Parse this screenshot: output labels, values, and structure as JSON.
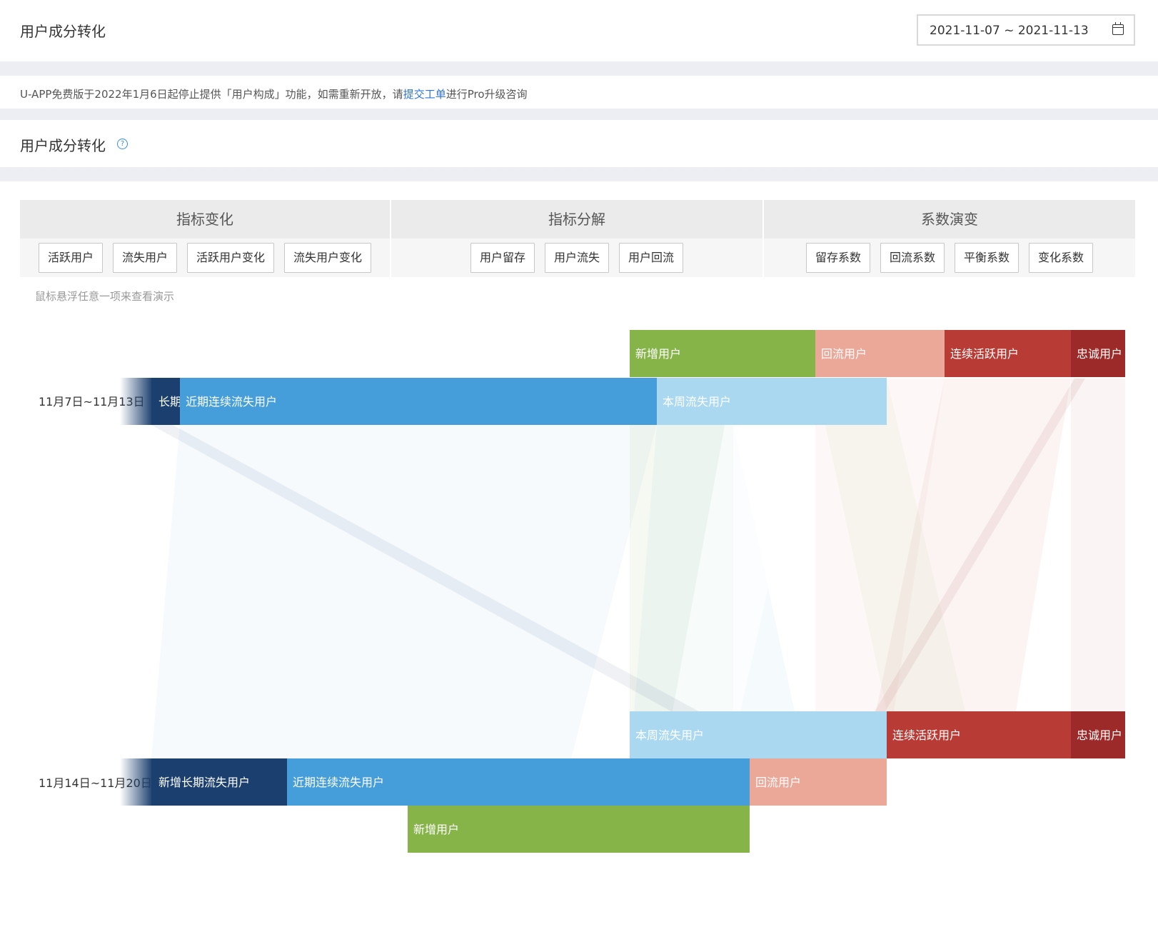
{
  "header": {
    "title": "用户成分转化",
    "date_range": "2021-11-07 ~ 2021-11-13",
    "calendar_icon": "calendar-icon"
  },
  "notice": {
    "text_before": "U-APP免费版于2022年1月6日起停止提供「用户构成」功能，如需重新开放，请",
    "link_text": "提交工单",
    "text_after": "进行Pro升级咨询"
  },
  "section": {
    "title": "用户成分转化",
    "help_icon": "question-circle-icon"
  },
  "tabs": [
    {
      "title": "指标变化",
      "buttons": [
        "活跃用户",
        "流失用户",
        "活跃用户变化",
        "流失用户变化"
      ]
    },
    {
      "title": "指标分解",
      "buttons": [
        "用户留存",
        "用户流失",
        "用户回流"
      ]
    },
    {
      "title": "系数演变",
      "buttons": [
        "留存系数",
        "回流系数",
        "平衡系数",
        "变化系数"
      ]
    }
  ],
  "hint": "鼠标悬浮任意一项来查看演示",
  "chart": {
    "colors": {
      "new": "#87b449",
      "return": "#eba797",
      "active": "#b83c35",
      "loyal": "#9c2a28",
      "long_lost": "#1b3f6e",
      "recent_lost": "#459ed9",
      "week_lost": "#aad8f0"
    },
    "week1": {
      "label": "11月7日~11月13日",
      "top_bars": [
        {
          "label": "新增用户",
          "color": "new"
        },
        {
          "label": "回流用户",
          "color": "return"
        },
        {
          "label": "连续活跃用户",
          "color": "active"
        },
        {
          "label": "忠诚用户",
          "color": "loyal"
        }
      ],
      "bars": [
        {
          "label": "长期",
          "color": "long_lost"
        },
        {
          "label": "近期连续流失用户",
          "color": "recent_lost"
        },
        {
          "label": "本周流失用户",
          "color": "week_lost"
        }
      ]
    },
    "week2": {
      "label": "11月14日~11月20日",
      "top_bars": [
        {
          "label": "本周流失用户",
          "color": "week_lost"
        },
        {
          "label": "连续活跃用户",
          "color": "active"
        },
        {
          "label": "忠诚用户",
          "color": "loyal"
        }
      ],
      "bars": [
        {
          "label": "新增长期流失用户",
          "color": "long_lost"
        },
        {
          "label": "近期连续流失用户",
          "color": "recent_lost"
        },
        {
          "label": "回流用户",
          "color": "return"
        }
      ],
      "bottom_bars": [
        {
          "label": "新增用户",
          "color": "new"
        }
      ]
    }
  }
}
